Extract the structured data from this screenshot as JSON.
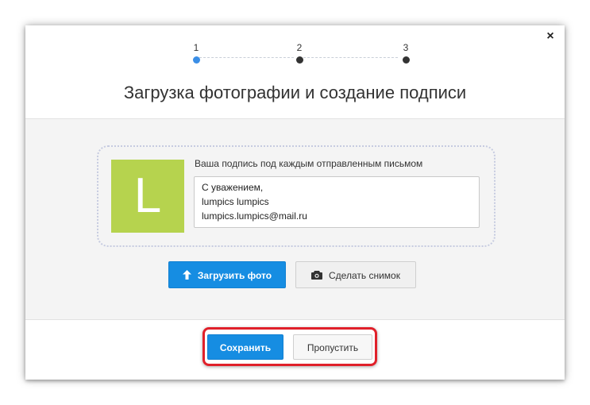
{
  "dialog": {
    "close_glyph": "×",
    "title": "Загрузка фотографии и создание подписи"
  },
  "stepper": {
    "steps": [
      "1",
      "2",
      "3"
    ],
    "active_step": 1
  },
  "avatar": {
    "letter": "L",
    "color": "#b6d34e"
  },
  "signature": {
    "label": "Ваша подпись под каждым отправленным письмом",
    "lines": [
      "С уважением,",
      "lumpics lumpics",
      "lumpics.lumpics@mail.ru"
    ]
  },
  "photo_actions": {
    "upload_label": "Загрузить фото",
    "upload_icon": "arrow-up-icon",
    "snapshot_label": "Сделать снимок",
    "snapshot_icon": "camera-icon"
  },
  "footer": {
    "save_label": "Сохранить",
    "skip_label": "Пропустить"
  },
  "colors": {
    "accent": "#168de2",
    "active_step": "#3a8ee6",
    "highlight": "#e0202a"
  }
}
